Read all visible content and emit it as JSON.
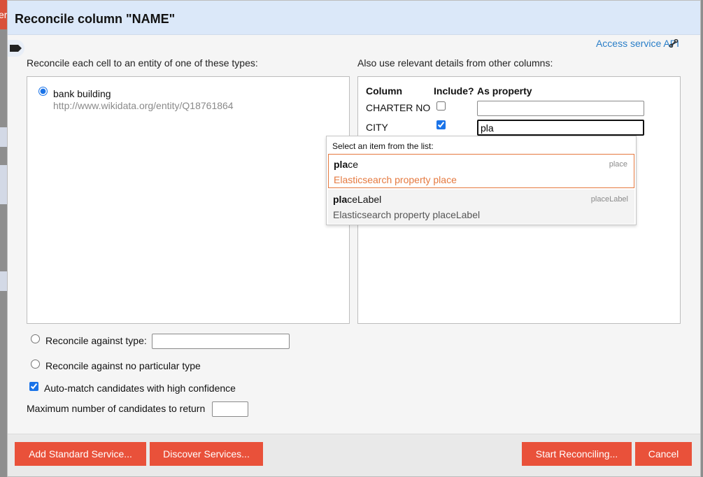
{
  "background": {
    "header_fragment": "er"
  },
  "dialog": {
    "title": "Reconcile column \"NAME\"",
    "service_link": "Access service API",
    "types_label": "Reconcile each cell to an entity of one of these types:",
    "details_label": "Also use relevant details from other columns:"
  },
  "types": [
    {
      "name": "bank building",
      "url": "http://www.wikidata.org/entity/Q18761864",
      "selected": true
    }
  ],
  "details": {
    "headers": {
      "column": "Column",
      "include": "Include?",
      "property": "As property"
    },
    "rows": [
      {
        "column": "CHARTER NO",
        "include": false,
        "property": ""
      },
      {
        "column": "CITY",
        "include": true,
        "property": "pla"
      }
    ]
  },
  "suggest": {
    "title": "Select an item from the list:",
    "items": [
      {
        "match": "pla",
        "rest": "ce",
        "id": "place",
        "description": "Elasticsearch property place",
        "selected": true
      },
      {
        "match": "pla",
        "rest": "ceLabel",
        "id": "placeLabel",
        "description": "Elasticsearch property placeLabel",
        "selected": false
      }
    ]
  },
  "options": {
    "against_type": "Reconcile against type:",
    "against_none": "Reconcile against no particular type",
    "auto_match": "Auto-match candidates with high confidence",
    "auto_match_checked": true,
    "max_candidates": "Maximum number of candidates to return"
  },
  "footer": {
    "add_standard": "Add Standard Service...",
    "discover": "Discover Services...",
    "start": "Start Reconciling...",
    "cancel": "Cancel"
  },
  "colors": {
    "accent": "#e9513a",
    "header_bg": "#dbe8f9",
    "link": "#2a7ec8",
    "highlight": "#e5793f"
  }
}
